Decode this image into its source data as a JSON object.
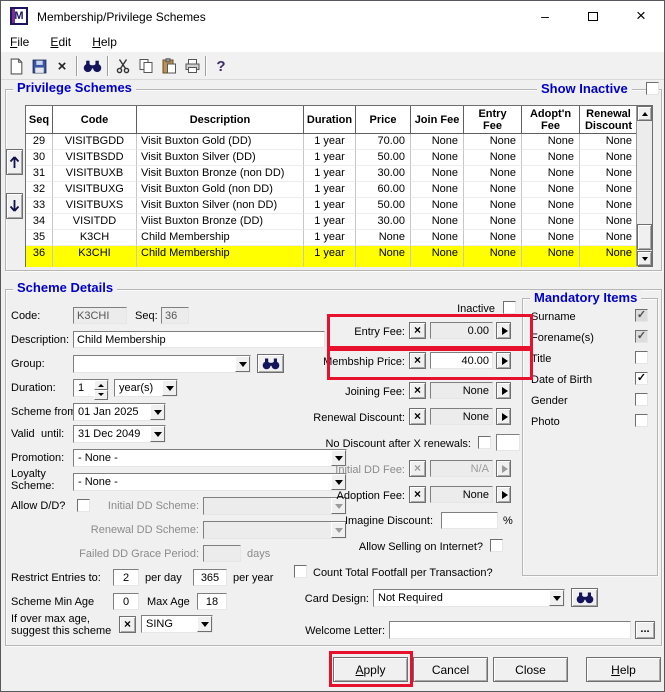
{
  "window": {
    "title": "Membership/Privilege Schemes",
    "logo_text": "M",
    "controls": {
      "minimize": "–",
      "close": "×"
    }
  },
  "menu": {
    "items": [
      "File",
      "Edit",
      "Help"
    ]
  },
  "toolbar": {
    "icons": [
      "new-document",
      "save",
      "delete",
      "find",
      "cut",
      "copy",
      "paste",
      "print",
      "help"
    ],
    "help_glyph": "?",
    "delete_glyph": "×"
  },
  "privilege_schemes": {
    "title": "Privilege Schemes",
    "show_inactive": "Show Inactive",
    "columns": [
      "Seq",
      "Code",
      "Description",
      "Duration",
      "Price",
      "Join Fee",
      "Entry\nFee",
      "Adopt'n\nFee",
      "Renewal\nDiscount"
    ],
    "selected_row_index": 7,
    "rows": [
      [
        "29",
        "VISITBGDD",
        "Visit Buxton Gold (DD)",
        "1 year",
        "70.00",
        "None",
        "None",
        "None",
        "None"
      ],
      [
        "30",
        "VISITBSDD",
        "Visit Buxton Silver (DD)",
        "1 year",
        "50.00",
        "None",
        "None",
        "None",
        "None"
      ],
      [
        "31",
        "VISITBUXB",
        "Visit Buxton Bronze (non DD)",
        "1 year",
        "30.00",
        "None",
        "None",
        "None",
        "None"
      ],
      [
        "32",
        "VISITBUXG",
        "Visit Buxton Gold (non DD)",
        "1 year",
        "60.00",
        "None",
        "None",
        "None",
        "None"
      ],
      [
        "33",
        "VISITBUXS",
        "Visit Buxton Silver (non DD)",
        "1 year",
        "50.00",
        "None",
        "None",
        "None",
        "None"
      ],
      [
        "34",
        "VISITDD",
        "Viist Buxton Bronze (DD)",
        "1 year",
        "30.00",
        "None",
        "None",
        "None",
        "None"
      ],
      [
        "35",
        "K3CH",
        "Child Membership",
        "1 year",
        "None",
        "None",
        "None",
        "None",
        "None"
      ],
      [
        "36",
        "K3CHI",
        "Child Membership",
        "1 year",
        "None",
        "None",
        "None",
        "None",
        "None"
      ]
    ]
  },
  "details": {
    "title": "Scheme Details",
    "code_label": "Code:",
    "code_value": "K3CHI",
    "seq_label": "Seq:",
    "seq_value": "36",
    "description_label": "Description:",
    "description_value": "Child Membership",
    "group_label": "Group:",
    "group_value": "",
    "duration_label": "Duration:",
    "duration_value": "1",
    "duration_unit": "year(s)",
    "scheme_from_label": "Scheme from",
    "valid_label": "Valid",
    "until_label": "until:",
    "valid_from": "01 Jan 2025",
    "valid_until": "31 Dec 2049",
    "promotion_label": "Promotion:",
    "promotion_value": "- None -",
    "loyalty_label_1": "Loyalty",
    "loyalty_label_2": "Scheme:",
    "loyalty_value": "- None -",
    "allow_dd_label": "Allow D/D?",
    "initial_dd_scheme_label": "Initial DD Scheme:",
    "initial_dd_scheme_value": "",
    "renewal_dd_scheme_label": "Renewal DD Scheme:",
    "renewal_dd_scheme_value": "",
    "failed_dd_label": "Failed DD Grace Period:",
    "failed_dd_value": "",
    "failed_dd_suffix": "days",
    "restrict_label": "Restrict Entries to:",
    "per_day_value": "2",
    "per_day_label": "per day",
    "per_year_value": "365",
    "per_year_label": "per year",
    "min_age_label": "Scheme Min Age",
    "min_age_value": "0",
    "max_age_label": "Max Age",
    "max_age_value": "18",
    "over_max_label_1": "If over max age,",
    "over_max_label_2": "suggest this scheme",
    "over_max_value": "SING",
    "inactive_label": "Inactive",
    "entry_fee_label": "Entry Fee:",
    "entry_fee_value": "0.00",
    "membship_price_label": "Membship Price:",
    "membship_price_value": "40.00",
    "joining_fee_label": "Joining Fee:",
    "joining_fee_value": "None",
    "renewal_discount_label": "Renewal Discount:",
    "renewal_discount_value": "None",
    "no_discount_label": "No Discount after X renewals:",
    "no_discount_value": "",
    "initial_dd_fee_label": "Initial DD Fee:",
    "initial_dd_fee_value": "N/A",
    "adoption_fee_label": "Adoption Fee:",
    "adoption_fee_value": "None",
    "imagine_discount_label": "Imagine Discount:",
    "imagine_discount_value": "",
    "imagine_discount_suffix": "%",
    "allow_internet_label": "Allow Selling on Internet?",
    "count_footfall_label": "Count Total Footfall per Transaction?",
    "card_design_label": "Card Design:",
    "card_design_value": "Not Required",
    "welcome_letter_label": "Welcome Letter:",
    "welcome_letter_value": "",
    "ellipsis_button": "...",
    "clear_glyph": "×"
  },
  "mandatory": {
    "title": "Mandatory Items",
    "items": [
      {
        "label": "Surname",
        "checked": true,
        "disabled": true
      },
      {
        "label": "Forename(s)",
        "checked": true,
        "disabled": true
      },
      {
        "label": "Title",
        "checked": false,
        "disabled": false
      },
      {
        "label": "Date of Birth",
        "checked": true,
        "disabled": false
      },
      {
        "label": "Gender",
        "checked": false,
        "disabled": false
      },
      {
        "label": "Photo",
        "checked": false,
        "disabled": false
      }
    ]
  },
  "footer": {
    "apply": "Apply",
    "cancel": "Cancel",
    "close": "Close",
    "help": "Help"
  },
  "annotation_color": "#e8112d"
}
